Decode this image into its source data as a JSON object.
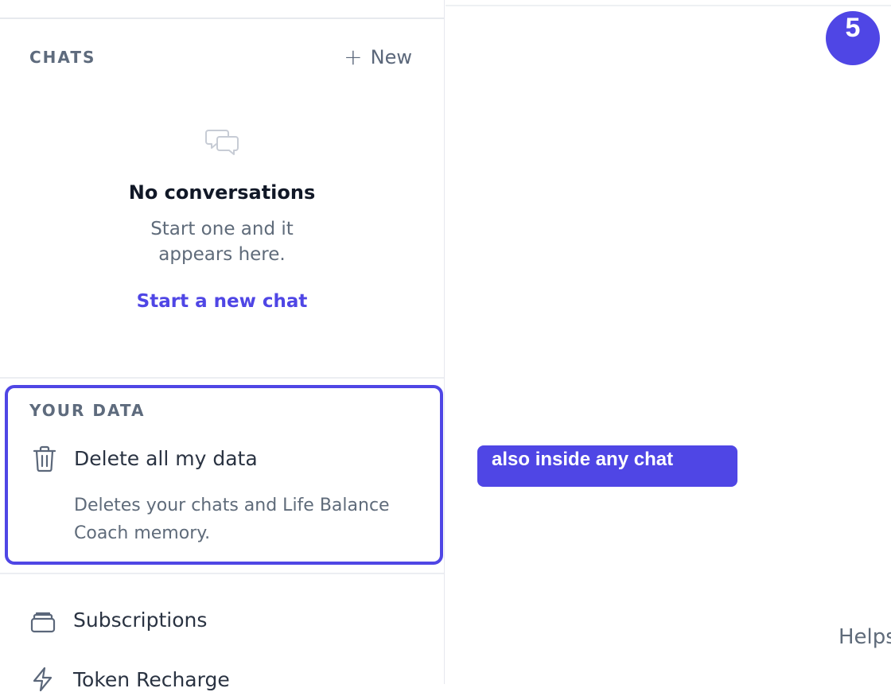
{
  "sidebar": {
    "chats": {
      "title": "CHATS",
      "new_label": "New",
      "empty_icon": "chat-bubbles-icon",
      "empty_title": "No conversations",
      "empty_subtitle_line1": "Start one and it",
      "empty_subtitle_line2": "appears here.",
      "empty_link": "Start a new chat"
    },
    "data": {
      "title": "YOUR DATA",
      "delete_label": "Delete all my data",
      "delete_description": "Deletes your chats and Life Balance Coach memory."
    },
    "menu": [
      {
        "label": "Subscriptions",
        "icon": "cards-icon"
      },
      {
        "label": "Token Recharge",
        "icon": "lightning-icon"
      }
    ]
  },
  "overlay": {
    "step_number": "5",
    "callout_text": "also inside any chat",
    "accent_color": "#4f46e5"
  },
  "main": {
    "partial_text": "Helps"
  }
}
